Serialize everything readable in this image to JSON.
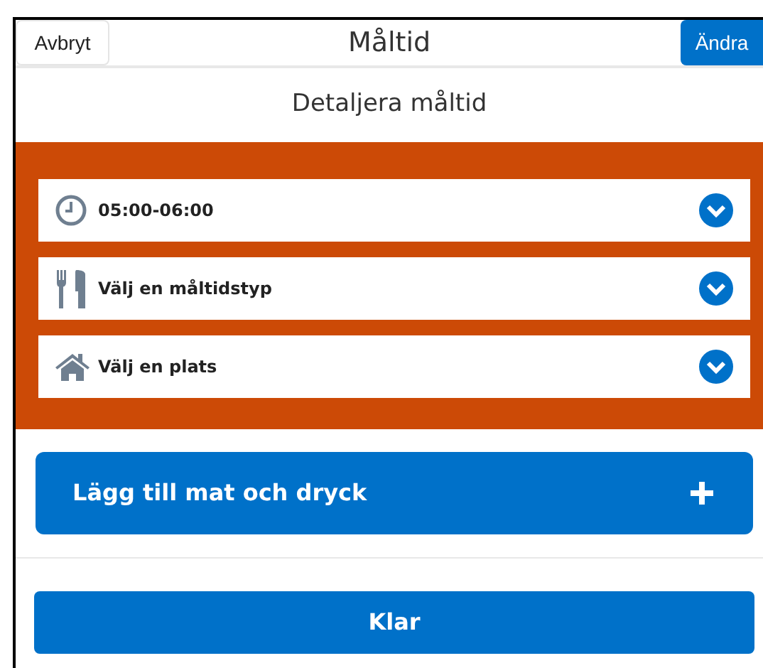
{
  "header": {
    "cancel_button": "Avbryt",
    "title": "Måltid",
    "edit_button": "Ändra"
  },
  "section_title": "Detaljera måltid",
  "fields": [
    {
      "kind": "time",
      "label": "05:00-06:00"
    },
    {
      "kind": "meal",
      "label": "Välj en måltidstyp"
    },
    {
      "kind": "place",
      "label": "Välj en plats"
    }
  ],
  "add_button": "Lägg till mat och dryck",
  "done_button": "Klar"
}
